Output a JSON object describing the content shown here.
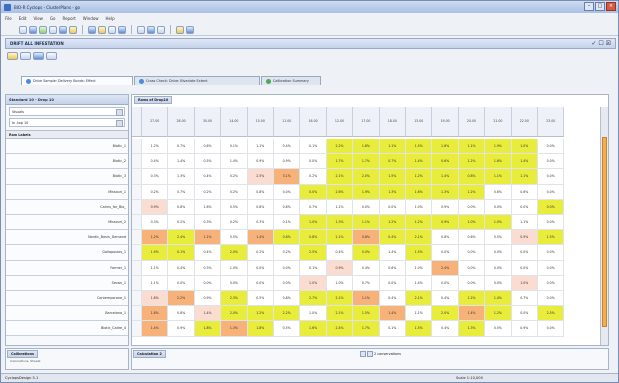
{
  "window": {
    "title": "BIO-R Cyclops - ClusterPlans - go"
  },
  "menu": [
    "File",
    "Edit",
    "View",
    "Go",
    "Report",
    "Window",
    "Help"
  ],
  "view": {
    "title": "DRIFT ALL INFESTATION",
    "controls": "✓ ☐ ☒"
  },
  "tabs": [
    {
      "label": "Drive Sample: Delivery Bonds: Effect"
    },
    {
      "label": "Cross Check: Drive: Bivariate Extent"
    },
    {
      "label": "Calibration Summary"
    }
  ],
  "left_pane": {
    "header": "Standard 10 - Drop 10",
    "controls": [
      "Visuals",
      "In .top 10"
    ],
    "row_header": "Row Labels",
    "rows": [
      "Biotic_1",
      "Biotic_2",
      "Biotic_3",
      "Missouri_1",
      "Cairns_for_Bio_",
      "Missouri_2",
      "Nordic_Basin_Demand",
      "Gallapoulos_1",
      "Farmer_1",
      "Sevan_1",
      "Contemporane_1",
      "Barcelona_1",
      "Biotic_Cadre_4"
    ]
  },
  "grid": {
    "header": "Rows of Drop10",
    "columns": [
      "27.00",
      "28.00",
      "30.00",
      "14.00",
      "15.00",
      "11.00",
      "16.00",
      "12.00",
      "17.00",
      "18.00",
      "13.00",
      "19.00",
      "20.00",
      "21.00",
      "22.00",
      "23.00"
    ],
    "rows": [
      [
        "1.2%",
        "0.7%",
        "0.6%",
        "0.1%",
        "1.1%",
        "0.4%",
        "0.1%",
        "2.2%",
        "1.8%",
        "1.1%",
        "1.5%",
        "1.6%",
        "1.1%",
        "1.9%",
        "1.0%",
        "0.0%"
      ],
      [
        "0.4%",
        "1.4%",
        "0.5%",
        "1.4%",
        "0.9%",
        "0.9%",
        "0.0%",
        "1.7%",
        "1.7%",
        "0.7%",
        "1.4%",
        "0.6%",
        "1.2%",
        "1.6%",
        "1.4%",
        "0.0%"
      ],
      [
        "0.3%",
        "1.3%",
        "0.4%",
        "0.2%",
        "2.5%",
        "3.1%",
        "0.2%",
        "2.1%",
        "2.0%",
        "1.5%",
        "1.2%",
        "1.4%",
        "0.8%",
        "1.1%",
        "1.1%",
        "0.0%"
      ],
      [
        "0.2%",
        "0.7%",
        "0.2%",
        "0.2%",
        "0.8%",
        "0.0%",
        "0.0%",
        "2.6%",
        "1.9%",
        "1.3%",
        "1.6%",
        "1.3%",
        "1.2%",
        "0.6%",
        "0.6%",
        "0.0%"
      ],
      [
        "0.9%",
        "0.8%",
        "1.6%",
        "0.5%",
        "0.8%",
        "0.8%",
        "0.7%",
        "1.1%",
        "0.0%",
        "0.0%",
        "1.0%",
        "0.9%",
        "0.0%",
        "0.0%",
        "0.0%",
        "0.0%"
      ],
      [
        "0.3%",
        "0.2%",
        "0.3%",
        "0.2%",
        "0.3%",
        "0.1%",
        "1.0%",
        "1.3%",
        "1.1%",
        "1.2%",
        "1.2%",
        "0.9%",
        "1.0%",
        "1.0%",
        "1.1%",
        "0.0%"
      ],
      [
        "1.2%",
        "2.4%",
        "1.1%",
        "0.5%",
        "1.4%",
        "0.8%",
        "0.8%",
        "2.1%",
        "0.8%",
        "0.4%",
        "2.1%",
        "0.8%",
        "0.6%",
        "0.5%",
        "0.9%",
        "1.5%"
      ],
      [
        "1.9%",
        "0.1%",
        "0.4%",
        "2.0%",
        "0.2%",
        "0.2%",
        "2.5%",
        "0.4%",
        "0.0%",
        "1.4%",
        "1.5%",
        "0.0%",
        "0.0%",
        "0.0%",
        "0.0%",
        "0.0%"
      ],
      [
        "1.1%",
        "0.4%",
        "0.3%",
        "1.0%",
        "0.0%",
        "0.0%",
        "0.1%",
        "0.9%",
        "0.4%",
        "0.6%",
        "1.0%",
        "2.4%",
        "0.0%",
        "0.0%",
        "0.0%",
        "0.0%"
      ],
      [
        "1.1%",
        "0.0%",
        "0.0%",
        "0.0%",
        "0.0%",
        "0.0%",
        "1.0%",
        "1.0%",
        "0.7%",
        "0.0%",
        "1.4%",
        "0.0%",
        "0.0%",
        "0.0%",
        "1.0%",
        "0.0%"
      ],
      [
        "1.8%",
        "2.2%",
        "0.9%",
        "2.3%",
        "0.5%",
        "0.8%",
        "2.7%",
        "2.1%",
        "1.1%",
        "0.4%",
        "2.1%",
        "0.4%",
        "1.2%",
        "1.4%",
        "0.7%",
        "0.0%"
      ],
      [
        "1.8%",
        "0.8%",
        "1.4%",
        "2.0%",
        "1.2%",
        "2.2%",
        "1.0%",
        "2.1%",
        "1.5%",
        "1.4%",
        "1.1%",
        "2.0%",
        "1.4%",
        "1.2%",
        "0.0%",
        "2.5%"
      ],
      [
        "1.4%",
        "0.9%",
        "1.8%",
        "1.3%",
        "1.8%",
        "0.5%",
        "1.6%",
        "2.4%",
        "1.7%",
        "0.1%",
        "1.5%",
        "0.4%",
        "1.3%",
        "0.5%",
        "0.9%",
        "0.0%"
      ]
    ],
    "heat": [
      [
        0,
        0,
        0,
        0,
        0,
        0,
        0,
        3,
        3,
        3,
        3,
        3,
        3,
        3,
        3,
        0
      ],
      [
        0,
        0,
        0,
        0,
        0,
        0,
        0,
        3,
        3,
        3,
        3,
        3,
        3,
        3,
        3,
        0
      ],
      [
        0,
        0,
        0,
        0,
        1,
        2,
        0,
        3,
        3,
        3,
        3,
        3,
        3,
        3,
        3,
        0
      ],
      [
        0,
        0,
        0,
        0,
        0,
        0,
        3,
        3,
        3,
        3,
        3,
        3,
        3,
        0,
        0,
        0
      ],
      [
        1,
        0,
        0,
        0,
        0,
        0,
        0,
        0,
        0,
        0,
        0,
        0,
        0,
        0,
        0,
        3
      ],
      [
        0,
        0,
        0,
        0,
        0,
        0,
        3,
        3,
        3,
        3,
        3,
        3,
        3,
        3,
        0,
        0
      ],
      [
        2,
        3,
        2,
        0,
        2,
        3,
        3,
        3,
        2,
        3,
        3,
        0,
        0,
        0,
        1,
        3
      ],
      [
        3,
        3,
        0,
        3,
        0,
        0,
        3,
        0,
        3,
        0,
        3,
        0,
        0,
        0,
        0,
        0
      ],
      [
        0,
        0,
        0,
        0,
        0,
        0,
        0,
        1,
        0,
        0,
        0,
        2,
        0,
        0,
        0,
        0
      ],
      [
        0,
        0,
        0,
        0,
        0,
        0,
        1,
        0,
        0,
        0,
        0,
        0,
        0,
        0,
        1,
        0
      ],
      [
        1,
        2,
        0,
        3,
        0,
        0,
        3,
        3,
        2,
        0,
        3,
        0,
        3,
        3,
        0,
        0
      ],
      [
        2,
        0,
        1,
        3,
        3,
        3,
        0,
        3,
        3,
        2,
        0,
        3,
        2,
        3,
        0,
        3
      ],
      [
        2,
        0,
        3,
        2,
        3,
        0,
        3,
        3,
        3,
        0,
        3,
        0,
        3,
        0,
        0,
        0
      ]
    ]
  },
  "colors": {
    "yellow": "#e8ec3a",
    "orange": "#f7b27a",
    "pink": "#fbdcd0",
    "plain": "#ffffff",
    "accent": "#3b6ec2"
  },
  "bottom": {
    "left_tag": "Calibrations",
    "left_note": "Calculations, Sheets",
    "mid_tag": "Calculation 2",
    "pager_label": "2 conservations"
  },
  "status": {
    "left": "CyclopsDesign 5.1",
    "right": "Scale 1:10,000"
  }
}
